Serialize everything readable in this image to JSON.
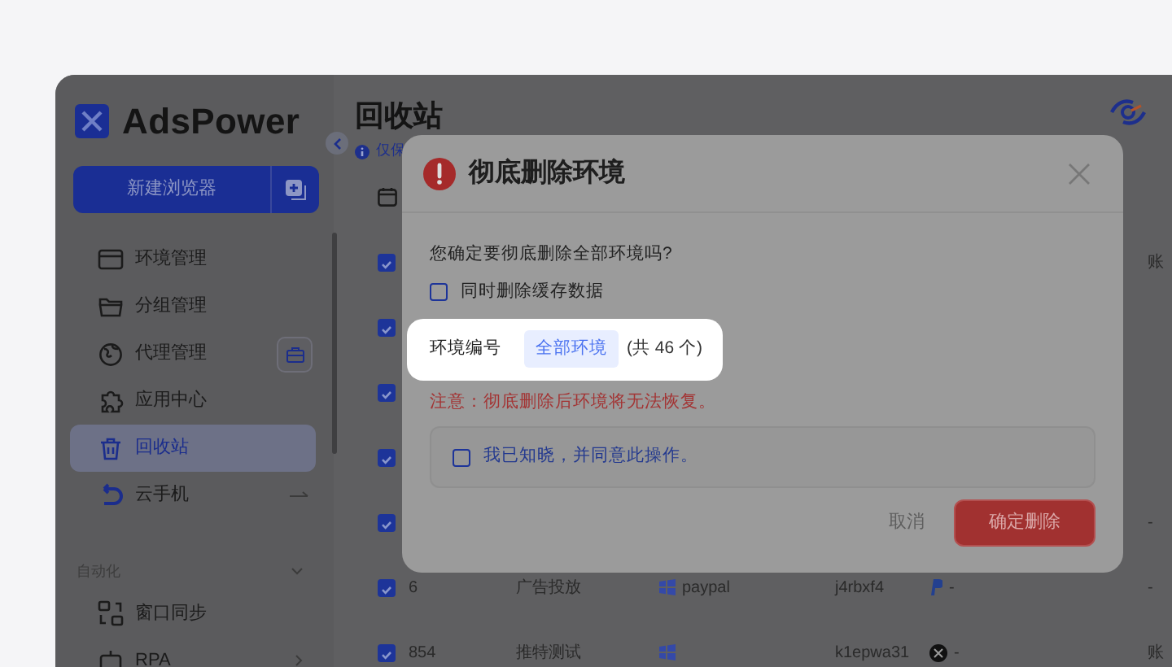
{
  "app": {
    "logo": "AdsPower",
    "new_browser_button": "新建浏览器"
  },
  "sidebar": {
    "items": [
      {
        "label": "环境管理",
        "selected": false,
        "kind": "plain"
      },
      {
        "label": "分组管理",
        "selected": false,
        "kind": "plain"
      },
      {
        "label": "代理管理",
        "selected": false,
        "kind": "with-button"
      },
      {
        "label": "应用中心",
        "selected": false,
        "kind": "plain"
      },
      {
        "label": "回收站",
        "selected": true,
        "kind": "plain"
      },
      {
        "label": "云手机",
        "selected": false,
        "kind": "with-arrow"
      }
    ],
    "section": {
      "label": "自动化",
      "expanded": true,
      "items": [
        {
          "label": "窗口同步",
          "selected": false,
          "kind": "plain"
        },
        {
          "label": "RPA",
          "selected": false,
          "kind": "with-chevron"
        }
      ]
    }
  },
  "page": {
    "title": "回收站",
    "notice": "仅保"
  },
  "table": {
    "rows": [
      {
        "checked": true,
        "tail": "账"
      },
      {
        "checked": true
      },
      {
        "checked": true
      },
      {
        "checked": true
      },
      {
        "checked": true,
        "tail": "-"
      },
      {
        "checked": true,
        "id": "6",
        "group": "广告投放",
        "platform": "paypal",
        "name": "j4rbxf4",
        "account": {
          "kind": "paypal",
          "text": "-"
        },
        "tail": "-"
      },
      {
        "checked": true,
        "id": "854",
        "group": "推特测试",
        "name": "k1epwa31",
        "account": {
          "kind": "x",
          "text": "-"
        },
        "tail": "账"
      }
    ]
  },
  "modal": {
    "title": "彻底删除环境",
    "question": "您确定要彻底删除全部环境吗?",
    "clear_cache": {
      "label": "同时删除缓存数据",
      "checked": false
    },
    "env_label": "环境编号",
    "env_chip": "全部环境",
    "env_count": "(共 46 个)",
    "warning": "注意：彻底删除后环境将无法恢复。",
    "agree": {
      "label": "我已知晓，并同意此操作。",
      "checked": false
    },
    "cancel_button": "取消",
    "confirm_button": "确定删除"
  }
}
